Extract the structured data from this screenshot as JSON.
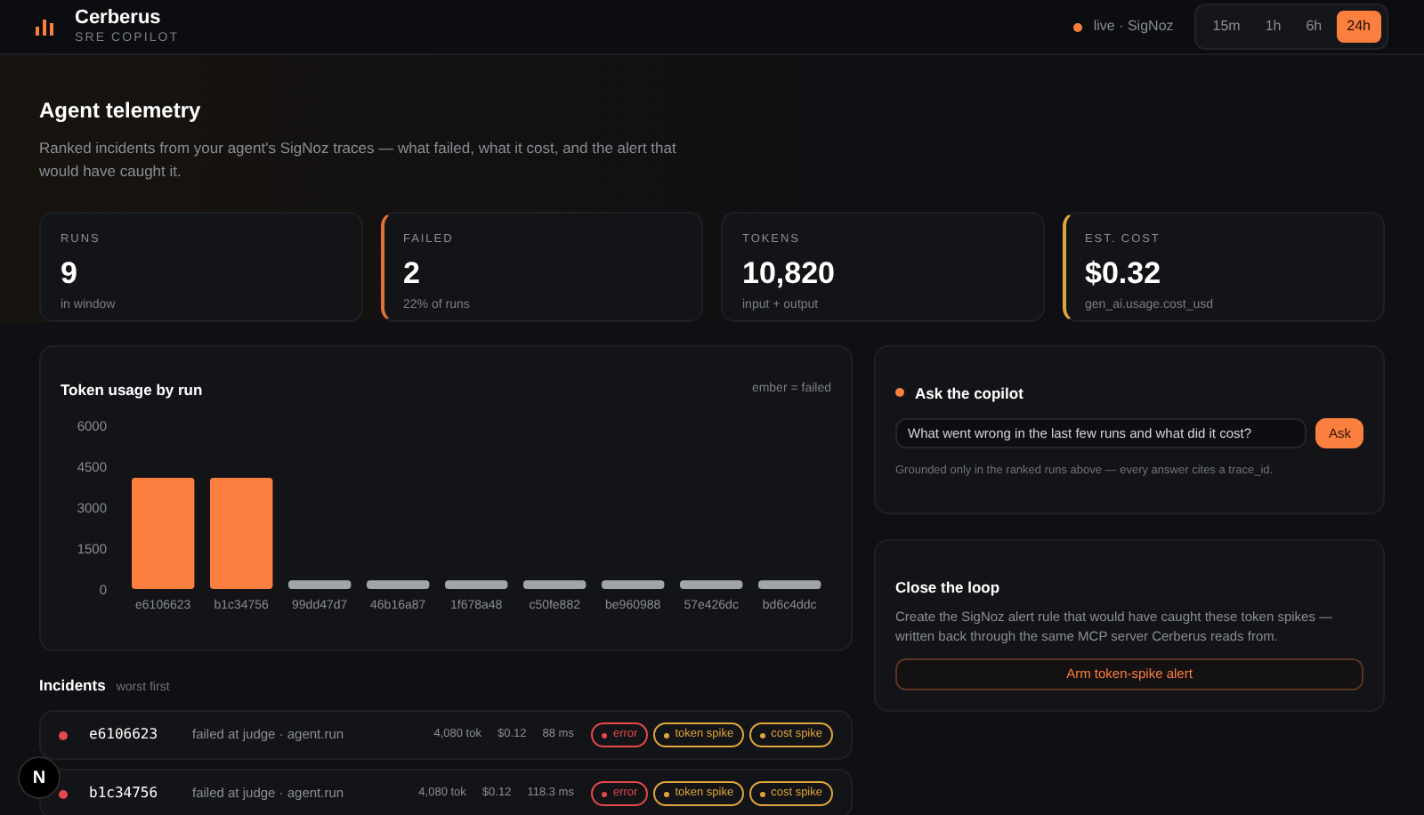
{
  "header": {
    "title": "Cerberus",
    "subtitle": "SRE COPILOT",
    "status": "live · SigNoz",
    "color": "#f97f3f",
    "ranges": [
      {
        "label": "15m",
        "selected": false
      },
      {
        "label": "1h",
        "selected": false
      },
      {
        "label": "6h",
        "selected": false
      },
      {
        "label": "24h",
        "selected": true
      }
    ]
  },
  "intro": {
    "title": "Agent telemetry",
    "description": "Ranked incidents from your agent's SigNoz traces — what failed, what it cost, and the alert that would have caught it."
  },
  "stats": [
    {
      "label": "RUNS",
      "value": "9",
      "note": "in window"
    },
    {
      "label": "FAILED",
      "value": "2",
      "note": "22% of runs",
      "color": "#e0713a"
    },
    {
      "label": "TOKENS",
      "value": "10,820",
      "note": "input + output"
    },
    {
      "label": "EST. COST",
      "value": "$0.32",
      "note": "gen_ai.usage.cost_usd",
      "color": "#e0a53a"
    }
  ],
  "chart": {
    "title": "Token usage by run",
    "legend": "ember = failed",
    "chart_data": {
      "type": "bar",
      "categories": [
        "e6106623",
        "b1c34756",
        "99dd47d7",
        "46b16a87",
        "1f678a48",
        "c50fe882",
        "be960988",
        "57e426dc",
        "bd6c4ddc"
      ],
      "stacked": true,
      "ylim": [
        0,
        6000
      ],
      "yticks": [
        0,
        1500,
        3000,
        4500,
        6000
      ],
      "series": [
        {
          "color": "#fb7f3f",
          "values": [
            4080,
            4080,
            null,
            null,
            null,
            null,
            null,
            null,
            null
          ]
        },
        {
          "color": "#a1a4ab",
          "values": [
            null,
            null,
            320,
            320,
            320,
            320,
            320,
            320,
            320
          ]
        }
      ]
    }
  },
  "copilot": {
    "title": "Ask the copilot",
    "color": "#f97f3f",
    "question": "What went wrong in the last few runs and what did it cost?",
    "button": "Ask",
    "note": "Grounded only in the ranked runs above — every answer cites a trace_id."
  },
  "close_loop": {
    "title": "Close the loop",
    "description": "Create the SigNoz alert rule that would have caught these token spikes — written back through the same MCP server Cerberus reads from.",
    "button": "Arm token-spike alert"
  },
  "incidents": {
    "title": "Incidents",
    "subtitle": "worst first",
    "rows": [
      {
        "id": "e6106623",
        "color": "#e5484d",
        "description": "failed at judge · agent.run",
        "tokens": "4,080 tok",
        "cost": "$0.12",
        "latency": "88 ms",
        "tags": [
          {
            "label": "error",
            "color": "#e5484d"
          },
          {
            "label": "token spike",
            "color": "#e0a53a"
          },
          {
            "label": "cost spike",
            "color": "#e0a53a"
          }
        ]
      },
      {
        "id": "b1c34756",
        "color": "#e5484d",
        "description": "failed at judge · agent.run",
        "tokens": "4,080 tok",
        "cost": "$0.12",
        "latency": "118.3 ms",
        "tags": [
          {
            "label": "error",
            "color": "#e5484d"
          },
          {
            "label": "token spike",
            "color": "#e0a53a"
          },
          {
            "label": "cost spike",
            "color": "#e0a53a"
          }
        ]
      }
    ]
  },
  "dev_badge": "N"
}
